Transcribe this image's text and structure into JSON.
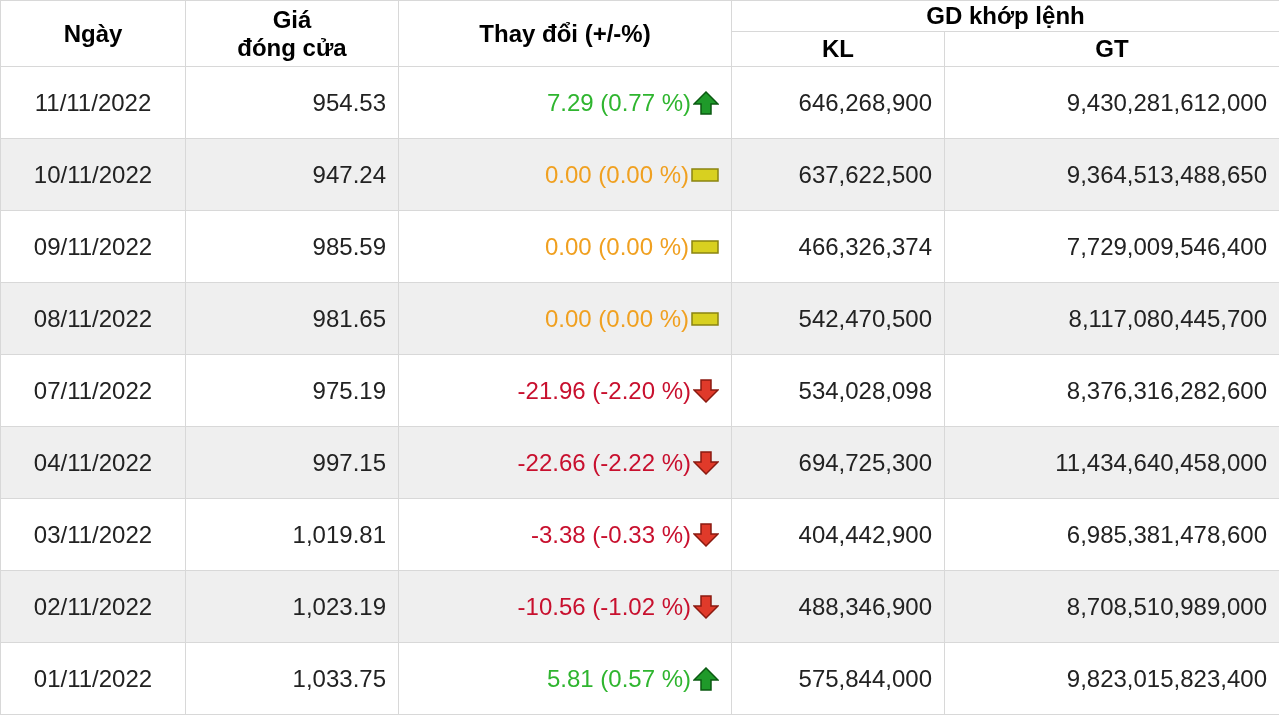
{
  "table": {
    "columns": {
      "date": "Ngày",
      "close": [
        "Giá",
        "đóng cửa"
      ],
      "change": "Thay đổi (+/-%)",
      "group": "GD khớp lệnh",
      "volume": "KL",
      "value": "GT"
    },
    "rows": [
      {
        "date": "11/11/2022",
        "close": "954.53",
        "change": "7.29 (0.77 %)",
        "kind": "up",
        "volume": "646,268,900",
        "value": "9,430,281,612,000"
      },
      {
        "date": "10/11/2022",
        "close": "947.24",
        "change": "0.00 (0.00 %)",
        "kind": "flat",
        "volume": "637,622,500",
        "value": "9,364,513,488,650"
      },
      {
        "date": "09/11/2022",
        "close": "985.59",
        "change": "0.00 (0.00 %)",
        "kind": "flat",
        "volume": "466,326,374",
        "value": "7,729,009,546,400"
      },
      {
        "date": "08/11/2022",
        "close": "981.65",
        "change": "0.00 (0.00 %)",
        "kind": "flat",
        "volume": "542,470,500",
        "value": "8,117,080,445,700"
      },
      {
        "date": "07/11/2022",
        "close": "975.19",
        "change": "-21.96 (-2.20 %)",
        "kind": "down",
        "volume": "534,028,098",
        "value": "8,376,316,282,600"
      },
      {
        "date": "04/11/2022",
        "close": "997.15",
        "change": "-22.66 (-2.22 %)",
        "kind": "down",
        "volume": "694,725,300",
        "value": "11,434,640,458,000"
      },
      {
        "date": "03/11/2022",
        "close": "1,019.81",
        "change": "-3.38 (-0.33 %)",
        "kind": "down",
        "volume": "404,442,900",
        "value": "6,985,381,478,600"
      },
      {
        "date": "02/11/2022",
        "close": "1,023.19",
        "change": "-10.56 (-1.02 %)",
        "kind": "down",
        "volume": "488,346,900",
        "value": "8,708,510,989,000"
      },
      {
        "date": "01/11/2022",
        "close": "1,033.75",
        "change": "5.81 (0.57 %)",
        "kind": "up",
        "volume": "575,844,000",
        "value": "9,823,015,823,400"
      }
    ]
  }
}
